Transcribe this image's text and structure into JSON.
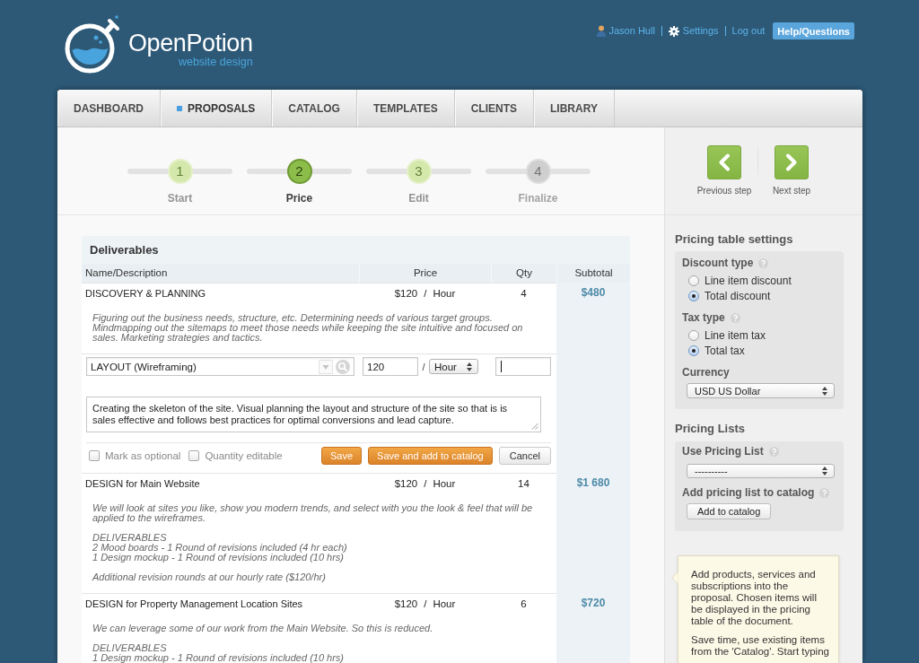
{
  "header": {
    "logo": {
      "name": "OpenPotion",
      "tagline": "website design"
    },
    "user_menu": {
      "items": [
        {
          "kind": "user",
          "label": "Jason Hull"
        },
        {
          "kind": "settings",
          "label": "Settings"
        },
        {
          "kind": "logout",
          "label": "Log out"
        }
      ],
      "help_button": "Help/Questions"
    }
  },
  "nav": {
    "tabs": [
      {
        "label": "DASHBOARD",
        "selected": false
      },
      {
        "label": "PROPOSALS",
        "selected": true
      },
      {
        "label": "CATALOG",
        "selected": false
      },
      {
        "label": "TEMPLATES",
        "selected": false
      },
      {
        "label": "CLIENTS",
        "selected": false
      },
      {
        "label": "LIBRARY",
        "selected": false
      }
    ]
  },
  "stepper": {
    "steps": [
      {
        "number": "1",
        "label": "Start",
        "selected": false,
        "disabled": false
      },
      {
        "number": "2",
        "label": "Price",
        "selected": true,
        "disabled": false
      },
      {
        "number": "3",
        "label": "Edit",
        "selected": false,
        "disabled": false
      },
      {
        "number": "4",
        "label": "Finalize",
        "selected": false,
        "disabled": true
      }
    ]
  },
  "deliverables": {
    "title": "Deliverables",
    "columns": [
      "Name/Description",
      "Price",
      "Qty",
      "Subtotal"
    ],
    "rows": [
      {
        "kind": "item",
        "name": "DISCOVERY & PLANNING",
        "price": "$120",
        "separator": "/",
        "unit": "Hour",
        "qty": "4",
        "subtotal": "$480",
        "description": [
          [
            "Figuring out the business needs, structure, etc. Determining needs of various target groups.",
            "Mindmapping out the sitemaps to meet those needs while keeping the site intuitive and focused on",
            "sales. Marketing strategies and tactics."
          ]
        ]
      },
      {
        "kind": "editor",
        "name_input": "LAYOUT (Wireframing)",
        "price_input": "120",
        "input_separator": "/",
        "unit_select": "Hour",
        "qty_focused": true,
        "description_input": "Creating the skeleton of the site. Visual planning the layout and structure of the site so that is is sales effective and follows best practices for optimal conversions and lead capture.",
        "options": [
          {
            "label": "Mark as optional",
            "checked": false
          },
          {
            "label": "Quantity editable",
            "checked": false
          }
        ],
        "buttons": [
          {
            "kind": "save",
            "label": "Save"
          },
          {
            "kind": "save_add",
            "label": "Save and add to catalog"
          },
          {
            "kind": "cancel",
            "label": "Cancel"
          }
        ]
      },
      {
        "kind": "item",
        "name": "DESIGN for Main Website",
        "price": "$120",
        "separator": "/",
        "unit": "Hour",
        "qty": "14",
        "subtotal": "$1 680",
        "description": [
          [
            "We will look at sites you like, show you modern trends, and select with you the look & feel that will be",
            "applied to the wireframes."
          ],
          [
            "DELIVERABLES",
            "2 Mood boards - 1 Round of revisions included (4 hr each)",
            "1 Design mockup - 1 Round of revisions included (10 hrs)"
          ],
          [
            "Additional revision rounds at our hourly rate ($120/hr)"
          ]
        ]
      },
      {
        "kind": "item",
        "name": "DESIGN for Property Management Location Sites",
        "price": "$120",
        "separator": "/",
        "unit": "Hour",
        "qty": "6",
        "subtotal": "$720",
        "description": [
          [
            "We can leverage some of our work from the Main Website. So this is reduced."
          ],
          [
            "DELIVERABLES",
            "1 Design mockup - 1 Round of revisions included (10 hrs)"
          ]
        ]
      }
    ]
  },
  "sidebar": {
    "step_nav": [
      {
        "kind": "previous",
        "label": "Previous step"
      },
      {
        "kind": "next",
        "label": "Next step"
      }
    ],
    "pricing_settings": {
      "title": "Pricing table settings",
      "groups": [
        {
          "label": "Discount type",
          "help": true,
          "options": [
            {
              "label": "Line item discount",
              "selected": false
            },
            {
              "label": "Total discount",
              "selected": true
            }
          ]
        },
        {
          "label": "Tax type",
          "help": true,
          "options": [
            {
              "label": "Line item tax",
              "selected": false
            },
            {
              "label": "Total tax",
              "selected": true
            }
          ]
        }
      ],
      "currency": {
        "label": "Currency",
        "help": false,
        "value": "USD US Dollar"
      }
    },
    "pricing_lists": {
      "title": "Pricing Lists",
      "use_list": {
        "label": "Use Pricing List",
        "help": true,
        "value": "----------"
      },
      "add_to_catalog": {
        "label": "Add pricing list to catalog",
        "help": true,
        "button": "Add to catalog"
      }
    },
    "hint": {
      "paragraphs": [
        [
          "Add products, services and",
          "subscriptions into the",
          "proposal. Chosen items will",
          "be displayed in the pricing",
          "table of the document."
        ],
        [
          "Save time, use existing items",
          "from the 'Catalog'. Start typing"
        ]
      ]
    }
  }
}
